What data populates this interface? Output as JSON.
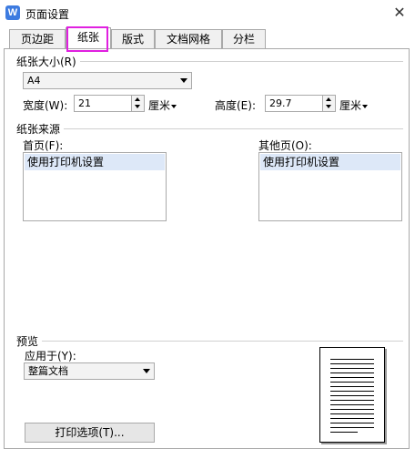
{
  "window": {
    "title": "页面设置",
    "app_icon": "W",
    "close_glyph": "✕"
  },
  "tabs": [
    {
      "label": "页边距"
    },
    {
      "label": "纸张"
    },
    {
      "label": "版式"
    },
    {
      "label": "文档网格"
    },
    {
      "label": "分栏"
    }
  ],
  "active_tab": "纸张",
  "highlight_color": "#e020e0",
  "paper_size": {
    "group_label": "纸张大小(R)",
    "selected": "A4",
    "width_label": "宽度(W):",
    "width_value": "21",
    "width_unit": "厘米",
    "height_label": "高度(E):",
    "height_value": "29.7",
    "height_unit": "厘米"
  },
  "paper_source": {
    "group_label": "纸张来源",
    "first_page_label": "首页(F):",
    "first_page_item": "使用打印机设置",
    "other_pages_label": "其他页(O):",
    "other_pages_item": "使用打印机设置"
  },
  "preview": {
    "group_label": "预览",
    "apply_to_label": "应用于(Y):",
    "apply_to_value": "整篇文档",
    "print_options_label": "打印选项(T)..."
  }
}
